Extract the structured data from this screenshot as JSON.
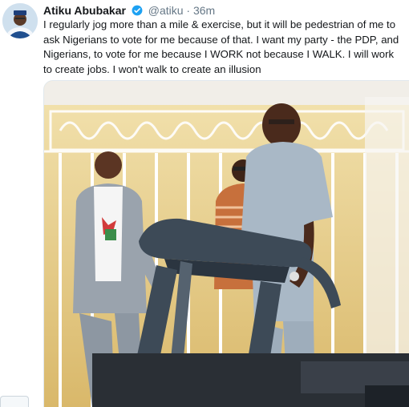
{
  "tweet": {
    "author_name": "Atiku Abubakar",
    "handle": "@atiku",
    "separator": "·",
    "time": "36m",
    "verified_icon": "verified-badge-icon",
    "text": "I regularly jog more than a mile & exercise, but it will be pedestrian of me to ask Nigerians to vote for me because of that. I want my party - the PDP, and Nigerians, to vote for me because I WORK not because I WALK. I will work to create jobs. I won't walk to create an illusion"
  },
  "colors": {
    "name": "#14171a",
    "meta": "#657786",
    "verified": "#1da1f2",
    "treadmill": "#3d4a57",
    "wall": "#e8c97a"
  },
  "media": {
    "description_icon": "photo-attachment"
  }
}
